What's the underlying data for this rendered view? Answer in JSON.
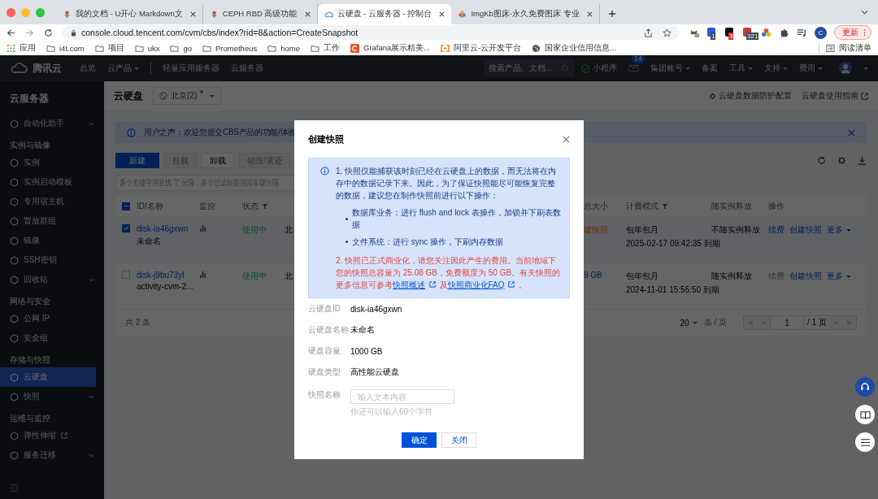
{
  "browser": {
    "tabs": [
      {
        "title": "我的文档 - U开心 Markdown文",
        "selected": false
      },
      {
        "title": "CEPH RBD 高级功能",
        "selected": false
      },
      {
        "title": "云硬盘 - 云服务器 - 控制台",
        "selected": true
      },
      {
        "title": "ImgKb图床-永久免费图床 专业",
        "selected": false
      }
    ],
    "url": "console.cloud.tencent.com/cvm/cbs/index?rid=8&action=CreateSnapshot",
    "extension_badges": [
      "1",
      "3",
      "321"
    ],
    "profile_initial": "C",
    "update_button": "更新",
    "bookmarks": [
      {
        "label": "应用",
        "kind": "apps"
      },
      {
        "label": "i4t.com",
        "kind": "folder"
      },
      {
        "label": "项目",
        "kind": "folder"
      },
      {
        "label": "ukx",
        "kind": "folder"
      },
      {
        "label": "go",
        "kind": "folder"
      },
      {
        "label": "Prometheus",
        "kind": "folder"
      },
      {
        "label": "home",
        "kind": "folder"
      },
      {
        "label": "工作",
        "kind": "folder"
      },
      {
        "label": "Grafana展示精美...",
        "kind": "site"
      },
      {
        "label": "阿里云-云开发平台",
        "kind": "bracket"
      },
      {
        "label": "国家企业信用信息...",
        "kind": "globe"
      }
    ],
    "reading_list": "阅读清单"
  },
  "topnav": {
    "brand": "腾讯云",
    "links": [
      {
        "label": "总览",
        "dropdown": false
      },
      {
        "label": "云产品",
        "dropdown": true
      },
      {
        "label": "轻量应用服务器",
        "dropdown": false
      },
      {
        "label": "云服务器",
        "dropdown": false
      }
    ],
    "search_placeholder": "搜索产品、文档...",
    "mini_program": "小程序",
    "mail_badge": "14",
    "right_links": [
      {
        "label": "集团账号",
        "dropdown": true
      },
      {
        "label": "备案",
        "dropdown": false
      },
      {
        "label": "工具",
        "dropdown": true
      },
      {
        "label": "支持",
        "dropdown": true
      },
      {
        "label": "费用",
        "dropdown": true
      }
    ]
  },
  "sidebar": {
    "title": "云服务器",
    "groups": [
      {
        "items": [
          {
            "label": "自动化助手",
            "selected": false,
            "expandable": true,
            "external": false
          }
        ]
      },
      {
        "label": "实例与镜像",
        "items": [
          {
            "label": "实例",
            "selected": false,
            "expandable": false,
            "external": false
          },
          {
            "label": "实例启动模板",
            "selected": false,
            "expandable": false,
            "external": false
          },
          {
            "label": "专用宿主机",
            "selected": false,
            "expandable": false,
            "external": false
          },
          {
            "label": "置放群组",
            "selected": false,
            "expandable": false,
            "external": false
          },
          {
            "label": "镜像",
            "selected": false,
            "expandable": false,
            "external": false
          },
          {
            "label": "SSH密钥",
            "selected": false,
            "expandable": false,
            "external": false
          },
          {
            "label": "回收站",
            "selected": false,
            "expandable": true,
            "external": false
          }
        ]
      },
      {
        "label": "网络与安全",
        "items": [
          {
            "label": "公网 IP",
            "selected": false,
            "expandable": false,
            "external": false
          },
          {
            "label": "安全组",
            "selected": false,
            "expandable": false,
            "external": false
          }
        ]
      },
      {
        "label": "存储与快照",
        "items": [
          {
            "label": "云硬盘",
            "selected": true,
            "expandable": false,
            "external": false
          },
          {
            "label": "快照",
            "selected": false,
            "expandable": true,
            "external": false
          }
        ]
      },
      {
        "label": "运维与监控",
        "items": [
          {
            "label": "弹性伸缩",
            "selected": false,
            "expandable": false,
            "external": true
          },
          {
            "label": "服务迁移",
            "selected": false,
            "expandable": true,
            "external": false
          }
        ]
      }
    ]
  },
  "page": {
    "title": "云硬盘",
    "region": "北京(2)",
    "header_links": [
      "云硬盘数据防护配置",
      "云硬盘使用指南"
    ],
    "banner": "用户之声：欢迎您提交CBS产品的功能/体验",
    "toolbar": [
      {
        "label": "新建",
        "kind": "primary",
        "disabled": false
      },
      {
        "label": "挂载",
        "kind": "default",
        "disabled": true
      },
      {
        "label": "卸载",
        "kind": "default",
        "disabled": false
      },
      {
        "label": "销毁/退还",
        "kind": "default",
        "disabled": true
      }
    ],
    "search_placeholder": "多个关键字用竖线 \"|\" 分隔，多个过滤标签用回车键分隔",
    "table": {
      "select_all_partial": true,
      "columns": [
        {
          "label": "ID/名称",
          "filter": false
        },
        {
          "label": "监控",
          "filter": false
        },
        {
          "label": "状态",
          "filter": true
        },
        {
          "label": "总大小",
          "filter": false
        },
        {
          "label": "计费模式",
          "filter": true
        },
        {
          "label": "随实例释放",
          "filter": false
        },
        {
          "label": "操作",
          "filter": false
        }
      ],
      "rows": [
        {
          "checked": true,
          "id": "disk-ia46gxwn",
          "name": "未命名",
          "status": "使用中",
          "column_4": "北",
          "size": {
            "text": "建快照",
            "kind": "warning"
          },
          "billing": "包年包月",
          "expiry": "2025-02-17 09:42:35 到期",
          "release": "不随实例释放",
          "actions": [
            {
              "label": "续费",
              "disabled": false
            },
            {
              "label": "创建快照",
              "disabled": false
            },
            {
              "label": "更多",
              "disabled": false
            }
          ]
        },
        {
          "checked": false,
          "id": "disk-j9bu73yl",
          "name": "activity-cvm-2...",
          "status": "使用中",
          "column_4": "北",
          "size": {
            "text": "9 GB",
            "kind": "link"
          },
          "billing": "包年包月",
          "expiry": "2024-11-01 15:55:50 到期",
          "release": "随实例释放",
          "actions": [
            {
              "label": "续费",
              "disabled": true
            },
            {
              "label": "创建快照",
              "disabled": false
            },
            {
              "label": "更多",
              "disabled": false
            }
          ]
        }
      ],
      "total": "共 2 条",
      "page_size": "20",
      "per_page": "条 / 页",
      "page": "1",
      "page_total": "/ 1 页"
    }
  },
  "dialog": {
    "title": "创建快照",
    "note_1": "1. 快照仅能捕获该时刻已经在云硬盘上的数据，而无法将在内存中的数据记录下来。因此，为了保证快照能尽可能恢复完整的数据，建议您在制作快照前进行以下操作：",
    "bullets": [
      "数据库业务：进行 flush and lock 表操作，加锁并下刷表数据",
      "文件系统：进行 sync 操作，下刷内存数据"
    ],
    "note_2": "2. 快照已正式商业化，请您关注因此产生的费用。当前地域下您的快照总容量为 25.08 GB，免费额度为 50 GB。有关快照的更多信息可参考",
    "note_2_links": [
      "快照概述",
      "快照商业化FAQ"
    ],
    "note_2_join": "及",
    "note_2_end": "。",
    "fields": [
      {
        "label": "云硬盘ID",
        "value": "disk-ia46gxwn"
      },
      {
        "label": "云硬盘名称",
        "value": "未命名"
      },
      {
        "label": "硬盘容量",
        "value": "1000 GB"
      },
      {
        "label": "硬盘类型",
        "value": "高性能云硬盘"
      }
    ],
    "input": {
      "label": "快照名称",
      "placeholder": "输入文本内容",
      "hint": "你还可以输入60个字符"
    },
    "buttons": [
      {
        "label": "确定",
        "kind": "primary"
      },
      {
        "label": "关闭",
        "kind": "default"
      }
    ]
  }
}
